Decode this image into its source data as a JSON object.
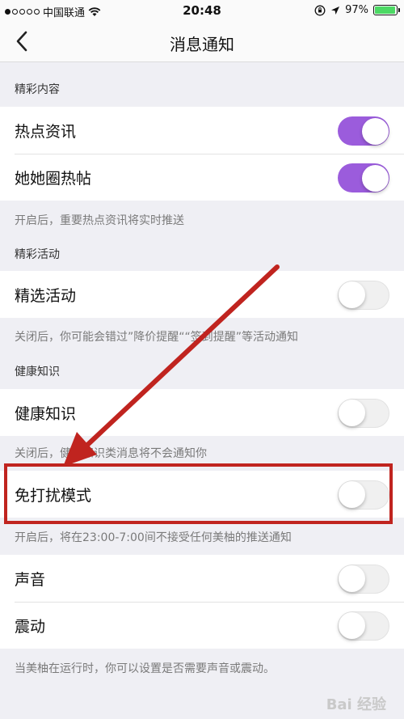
{
  "status_bar": {
    "carrier": "中国联通",
    "time": "20:48",
    "battery": "97%",
    "battery_level": 0.97
  },
  "nav": {
    "title": "消息通知"
  },
  "sections": [
    {
      "header": "精彩内容",
      "rows": [
        {
          "label": "热点资讯",
          "on": true
        },
        {
          "label": "她她圈热帖",
          "on": true
        }
      ],
      "note": "开启后，重要热点资讯将实时推送"
    },
    {
      "header": "精彩活动",
      "rows": [
        {
          "label": "精选活动",
          "on": false
        }
      ],
      "note": "关闭后，你可能会错过”降价提醒““签到提醒”等活动通知"
    },
    {
      "header": "健康知识",
      "rows": [
        {
          "label": "健康知识",
          "on": false
        }
      ],
      "note": "关闭后，健康知识类消息将不会通知你"
    },
    {
      "rows": [
        {
          "label": "免打扰模式",
          "on": false
        }
      ],
      "note": "开启后，将在23:00-7:00间不接受任何美柚的推送通知"
    },
    {
      "rows": [
        {
          "label": "声音",
          "on": false
        },
        {
          "label": "震动",
          "on": false
        }
      ],
      "note": "当美柚在运行时，你可以设置是否需要声音或震动。"
    }
  ],
  "colors": {
    "toggle_on": "#9b5cdc",
    "highlight": "#c0241f",
    "battery": "#4cd964"
  },
  "watermark": "Bai 经验"
}
